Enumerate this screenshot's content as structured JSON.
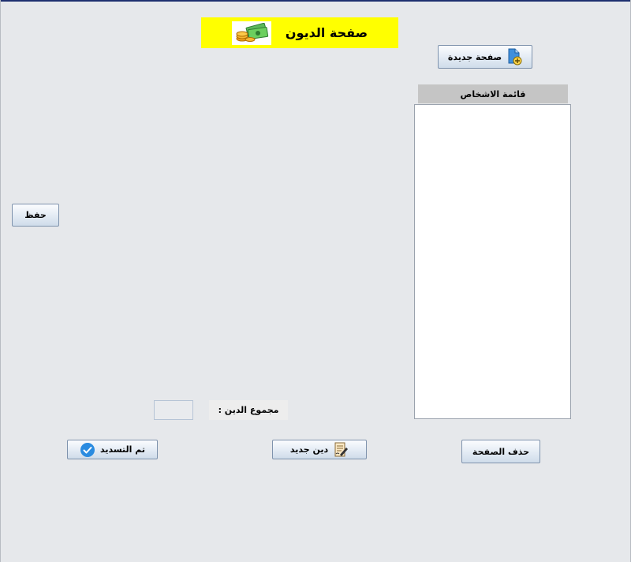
{
  "header": {
    "title": "صفحة الديون",
    "icon": "money-stack-icon"
  },
  "toolbar": {
    "new_page_label": "صفحة جديدة",
    "save_label": "حفظ",
    "delete_page_label": "حذف الصفحة",
    "new_debt_label": "دين جديد",
    "paid_label": "تم التسديد"
  },
  "people_list": {
    "header": "قائمة الاشخاص",
    "items": []
  },
  "total": {
    "label": "مجموع الدين :",
    "value": ""
  },
  "colors": {
    "title_background": "#ffff00",
    "window_background": "#e6e8eb",
    "check_icon": "#2a8be0"
  }
}
